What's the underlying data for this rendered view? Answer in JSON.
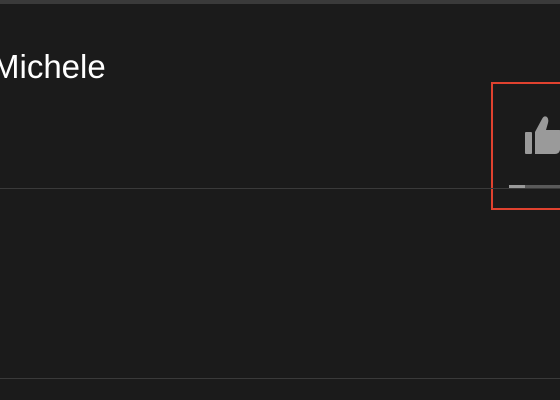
{
  "video": {
    "title_fragment": "Michele"
  },
  "like_control": {
    "icon": "thumbs-up-icon",
    "like_ratio": 0.26
  },
  "colors": {
    "background": "#1b1b1b",
    "highlight_border": "#e0422f",
    "icon": "#9a9a9a"
  }
}
